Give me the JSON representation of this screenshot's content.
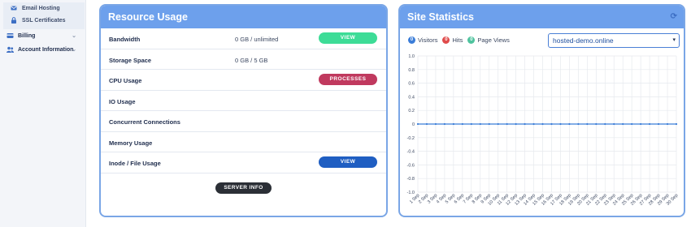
{
  "sidebar": {
    "sub_items": [
      {
        "label": "Email Hosting",
        "icon": "envelope-icon"
      },
      {
        "label": "SSL Certificates",
        "icon": "lock-icon"
      }
    ],
    "menu": [
      {
        "label": "Billing",
        "icon": "billing-icon"
      },
      {
        "label": "Account Information",
        "icon": "users-icon"
      }
    ]
  },
  "resource": {
    "title": "Resource Usage",
    "rows": [
      {
        "label": "Bandwidth",
        "value": "0 GB / unlimited",
        "button": "VIEW"
      },
      {
        "label": "Storage Space",
        "value": "0 GB / 5 GB"
      },
      {
        "label": "CPU Usage",
        "value": "",
        "button": "PROCESSES"
      },
      {
        "label": "IO Usage",
        "value": ""
      },
      {
        "label": "Concurrent Connections",
        "value": ""
      },
      {
        "label": "Memory Usage",
        "value": ""
      },
      {
        "label": "Inode / File Usage",
        "value": "",
        "button": "VIEW"
      }
    ],
    "server_info": "SERVER INFO"
  },
  "stats": {
    "title": "Site Statistics",
    "legend": [
      {
        "count": "0",
        "label": "Visitors",
        "color": "#3b7dd8"
      },
      {
        "count": "0",
        "label": "Hits",
        "color": "#e04b4b"
      },
      {
        "count": "0",
        "label": "Page Views",
        "color": "#4fc39e"
      }
    ],
    "domain_selected": "hosted-demo.online",
    "chart_data": {
      "type": "line",
      "x": [
        "1 Sep",
        "2 Sep",
        "3 Sep",
        "4 Sep",
        "5 Sep",
        "6 Sep",
        "7 Sep",
        "8 Sep",
        "9 Sep",
        "10 Sep",
        "11 Sep",
        "12 Sep",
        "13 Sep",
        "14 Sep",
        "15 Sep",
        "16 Sep",
        "17 Sep",
        "18 Sep",
        "19 Sep",
        "20 Sep",
        "21 Sep",
        "22 Sep",
        "23 Sep",
        "24 Sep",
        "25 Sep",
        "26 Sep",
        "27 Sep",
        "28 Sep",
        "29 Sep",
        "30 Sep"
      ],
      "series": [
        {
          "values": [
            0,
            0,
            0,
            0,
            0,
            0,
            0,
            0,
            0,
            0,
            0,
            0,
            0,
            0,
            0,
            0,
            0,
            0,
            0,
            0,
            0,
            0,
            0,
            0,
            0,
            0,
            0,
            0,
            0,
            0
          ],
          "color": "#3b7dd8"
        }
      ],
      "ylim": [
        -1.0,
        1.0
      ],
      "yticks": [
        "1.0",
        "0.8",
        "0.6",
        "0.4",
        "0.2",
        "0",
        "-0.2",
        "-0.4",
        "-0.6",
        "-0.8",
        "-1.0"
      ],
      "grid": true
    }
  }
}
